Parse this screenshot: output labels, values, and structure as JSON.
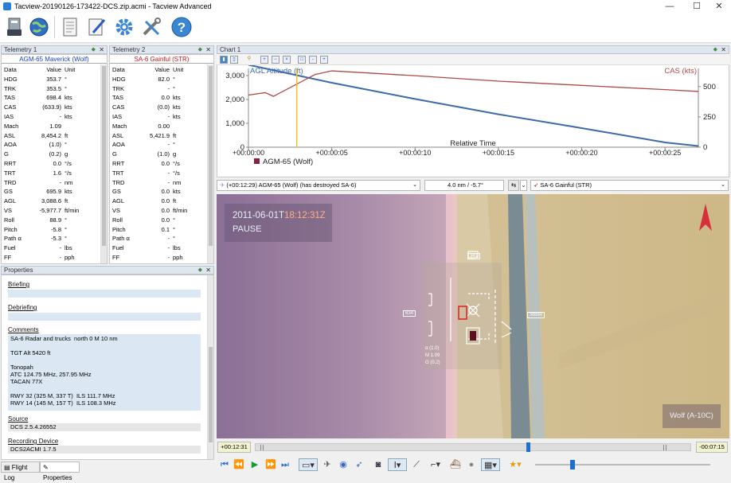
{
  "window": {
    "title": "Tacview-20190126-173422-DCS.zip.acmi - Tacview Advanced",
    "minimize": "—",
    "maximize": "☐",
    "close": "✕"
  },
  "toolbar": {
    "icons": [
      "flash-drive-icon",
      "globe-icon",
      "document-icon",
      "pen-document-icon",
      "gear-icon",
      "tools-icon",
      "help-icon"
    ],
    "help_glyph": "?"
  },
  "telemetry1": {
    "title": "Telemetry 1",
    "entity": "AGM-65 Maverick (Wolf)",
    "header": [
      "Data",
      "Value",
      "Unit"
    ],
    "rows": [
      [
        "HDG",
        "353.7",
        "°"
      ],
      [
        "TRK",
        "353.5",
        "°"
      ],
      [
        "TAS",
        "698.4",
        "kts"
      ],
      [
        "CAS",
        "(633.9)",
        "kts"
      ],
      [
        "IAS",
        "-",
        "kts"
      ],
      [
        "Mach",
        "1.09",
        ""
      ],
      [
        "ASL",
        "8,454.2",
        "ft"
      ],
      [
        "AOA",
        "(1.0)",
        "°"
      ],
      [
        "G",
        "(0.2)",
        "g"
      ],
      [
        "RRT",
        "0.0",
        "°/s"
      ],
      [
        "TRT",
        "1.6",
        "°/s"
      ],
      [
        "TRD",
        "-",
        "nm"
      ],
      [
        "GS",
        "695.9",
        "kts"
      ],
      [
        "AGL",
        "3,088.6",
        "ft"
      ],
      [
        "VS",
        "-5,977.7",
        "ft/min"
      ],
      [
        "Roll",
        "88.9",
        "°"
      ],
      [
        "Pitch",
        "-5.8",
        "°"
      ],
      [
        "Path α",
        "-5.3",
        "°"
      ],
      [
        "Fuel",
        "-",
        "lbs"
      ],
      [
        "FF",
        "-",
        "pph"
      ]
    ]
  },
  "telemetry2": {
    "title": "Telemetry 2",
    "entity": "SA-6 Gainful (STR)",
    "header": [
      "Data",
      "Value",
      "Unit"
    ],
    "rows": [
      [
        "HDG",
        "82.0",
        "°"
      ],
      [
        "TRK",
        "-",
        "°"
      ],
      [
        "TAS",
        "0.0",
        "kts"
      ],
      [
        "CAS",
        "(0.0)",
        "kts"
      ],
      [
        "IAS",
        "-",
        "kts"
      ],
      [
        "Mach",
        "0.00",
        ""
      ],
      [
        "ASL",
        "5,421.9",
        "ft"
      ],
      [
        "AOA",
        "-",
        "°"
      ],
      [
        "G",
        "(1.0)",
        "g"
      ],
      [
        "RRT",
        "0.0",
        "°/s"
      ],
      [
        "TRT",
        "-",
        "°/s"
      ],
      [
        "TRD",
        "-",
        "nm"
      ],
      [
        "GS",
        "0.0",
        "kts"
      ],
      [
        "AGL",
        "0.0",
        "ft"
      ],
      [
        "VS",
        "0.0",
        "ft/min"
      ],
      [
        "Roll",
        "0.0",
        "°"
      ],
      [
        "Pitch",
        "0.1",
        "°"
      ],
      [
        "Path α",
        "-",
        "°"
      ],
      [
        "Fuel",
        "-",
        "lbs"
      ],
      [
        "FF",
        "-",
        "pph"
      ]
    ]
  },
  "properties": {
    "title": "Properties",
    "briefing_label": "Briefing",
    "debriefing_label": "Debriefing",
    "comments_label": "Comments",
    "comments": "SA-6 Radar and trucks  north 0 M 10 nm\n\nTGT Alt 5420 ft\n\nTonopah\nATC 124.75 MHz, 257.95 MHz\nTACAN 77X\n\nRWY 32 (325 M, 337 T)  ILS 111.7 MHz\nRWY 14 (145 M, 157 T)  ILS 108.3 MHz",
    "source_label": "Source",
    "source": "DCS 2.5.4.26552",
    "recording_label": "Recording Device",
    "recording": "DCS2ACMI 1.7.5"
  },
  "bottom_tabs": [
    "Flight Log",
    "Properties"
  ],
  "chart_panel": {
    "title": "Chart 1"
  },
  "chart_data": {
    "type": "line",
    "xlabel": "Relative Time",
    "x_ticks": [
      "+00:00:00",
      "+00:00:05",
      "+00:00:10",
      "+00:00:15",
      "+00:00:20",
      "+00:00:25"
    ],
    "y_left_ticks": [
      "3,000",
      "2,000",
      "1,000",
      "0"
    ],
    "y_right_ticks": [
      "500",
      "250",
      "0"
    ],
    "y_left_range": [
      0,
      3300
    ],
    "y_right_range": [
      0,
      650
    ],
    "x_range": [
      0,
      27
    ],
    "series": [
      {
        "name": "AGL Altitude (ft)",
        "axis": "left",
        "color": "#3d6aa8",
        "x": [
          0,
          5,
          10,
          15,
          20,
          25,
          27
        ],
        "y": [
          3450,
          2700,
          2020,
          1380,
          800,
          200,
          50
        ]
      },
      {
        "name": "CAS (kts)",
        "axis": "right",
        "color": "#b04848",
        "x": [
          0,
          1,
          1.5,
          4,
          5,
          10,
          15,
          20,
          25,
          27
        ],
        "y": [
          430,
          450,
          420,
          600,
          630,
          590,
          545,
          510,
          475,
          460
        ]
      }
    ],
    "cursor_x": 2.9,
    "legend": [
      "AGM-65 (Wolf)"
    ]
  },
  "event_bar": {
    "event": "(+00:12:29) AGM-65 (Wolf) (has destroyed SA-6)",
    "range": "4.0 nm / -5.7°",
    "target": "SA-6 Gainful (STR)"
  },
  "view": {
    "date": "2011-06-01T",
    "time": "18:12:31Z",
    "state": "PAUSE",
    "callsign": "Wolf (A-10C)",
    "hud": {
      "heading": "341",
      "speed": "634",
      "right_readout": "3089R",
      "alpha": "α  (1.0)",
      "mach": "M  1.09",
      "g": "G  (0.2)"
    }
  },
  "timeline": {
    "current": "+00:12:31",
    "remaining": "-00:07:15",
    "progress": 0.62
  },
  "controls": {
    "icons": [
      "skip-start-icon",
      "rewind-icon",
      "play-icon",
      "fast-forward-icon",
      "skip-end-icon",
      "camera-view-icon",
      "aircraft-icon",
      "globe-icon",
      "missile-icon",
      "cockpit-icon",
      "text-cursor-icon",
      "axes-icon",
      "track-icon",
      "ship-icon",
      "sphere-icon",
      "layout-icon",
      "star-icon"
    ],
    "speed_level": 0.2
  }
}
